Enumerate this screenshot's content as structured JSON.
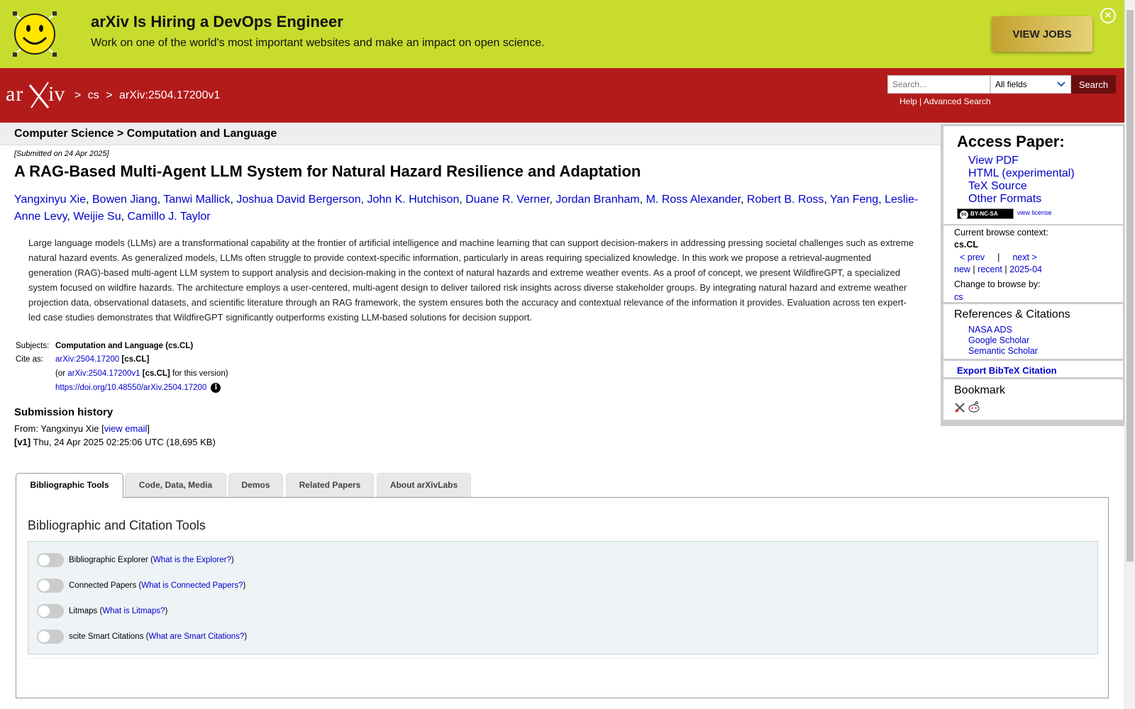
{
  "banner": {
    "title": "arXiv Is Hiring a DevOps Engineer",
    "subtitle": "Work on one of the world's most important websites and make an impact on open science.",
    "button": "VIEW JOBS",
    "close": "×"
  },
  "header": {
    "logo": "arXiv",
    "breadcrumb": [
      ">",
      "cs",
      ">",
      "arXiv:2504.17200v1"
    ],
    "search_placeholder": "Search...",
    "search_field": "All fields",
    "search_button": "Search",
    "help": "Help",
    "separator": "|",
    "advanced": "Advanced Search"
  },
  "paper": {
    "category": "Computer Science > Computation and Language",
    "submitted": "[Submitted on 24 Apr 2025]",
    "title": "A RAG-Based Multi-Agent LLM System for Natural Hazard Resilience and Adaptation",
    "authors": [
      "Yangxinyu Xie",
      "Bowen Jiang",
      "Tanwi Mallick",
      "Joshua David Bergerson",
      "John K. Hutchison",
      "Duane R. Verner",
      "Jordan Branham",
      "M. Ross Alexander",
      "Robert B. Ross",
      "Yan Feng",
      "Leslie-Anne Levy",
      "Weijie Su",
      "Camillo J. Taylor"
    ],
    "abstract": "Large language models (LLMs) are a transformational capability at the frontier of artificial intelligence and machine learning that can support decision-makers in addressing pressing societal challenges such as extreme natural hazard events. As generalized models, LLMs often struggle to provide context-specific information, particularly in areas requiring specialized knowledge. In this work we propose a retrieval-augmented generation (RAG)-based multi-agent LLM system to support analysis and decision-making in the context of natural hazards and extreme weather events. As a proof of concept, we present WildfireGPT, a specialized system focused on wildfire hazards. The architecture employs a user-centered, multi-agent design to deliver tailored risk insights across diverse stakeholder groups. By integrating natural hazard and extreme weather projection data, observational datasets, and scientific literature through an RAG framework, the system ensures both the accuracy and contextual relevance of the information it provides. Evaluation across ten expert-led case studies demonstrates that WildfireGPT significantly outperforms existing LLM-based solutions for decision support.",
    "subjects_label": "Subjects:",
    "subjects": "Computation and Language (cs.CL)",
    "cite_label": "Cite as:",
    "cite_id": "arXiv:2504.17200",
    "cite_cat": "[cs.CL]",
    "cite_or": "(or",
    "cite_version": "arXiv:2504.17200v1",
    "cite_version_tail": "for this version)",
    "doi": "https://doi.org/10.48550/arXiv.2504.17200",
    "info_icon": "i"
  },
  "history": {
    "heading": "Submission history",
    "from_prefix": "From: Yangxinyu Xie [",
    "view_email": "view email",
    "from_suffix": "]",
    "v1_label": "[v1]",
    "v1_text": "Thu, 24 Apr 2025 02:25:06 UTC (18,695 KB)"
  },
  "tabs": [
    "Bibliographic Tools",
    "Code, Data, Media",
    "Demos",
    "Related Papers",
    "About arXivLabs"
  ],
  "panel": {
    "heading": "Bibliographic and Citation Tools",
    "tools": [
      {
        "name": "Bibliographic Explorer",
        "link": "What is the Explorer?"
      },
      {
        "name": "Connected Papers",
        "link": "What is Connected Papers?"
      },
      {
        "name": "Litmaps",
        "link": "What is Litmaps?"
      },
      {
        "name": "scite Smart Citations",
        "link": "What are Smart Citations?"
      }
    ]
  },
  "sidebar": {
    "access_heading": "Access Paper:",
    "access_links": [
      "View PDF",
      "HTML (experimental)",
      "TeX Source",
      "Other Formats"
    ],
    "license_badge": "BY-NC-SA",
    "license_cc": "cc",
    "view_license": "view license",
    "context_label": "Current browse context:",
    "context_value": "cs.CL",
    "prev": "< prev",
    "pipe": "|",
    "next": "next >",
    "new": "new",
    "recent": "recent",
    "month": "2025-04",
    "change_label": "Change to browse by:",
    "change_value": "cs",
    "refs_heading": "References & Citations",
    "refs_links": [
      "NASA ADS",
      "Google Scholar",
      "Semantic Scholar"
    ],
    "bibtex": "Export BibTeX Citation",
    "bookmark": "Bookmark"
  }
}
